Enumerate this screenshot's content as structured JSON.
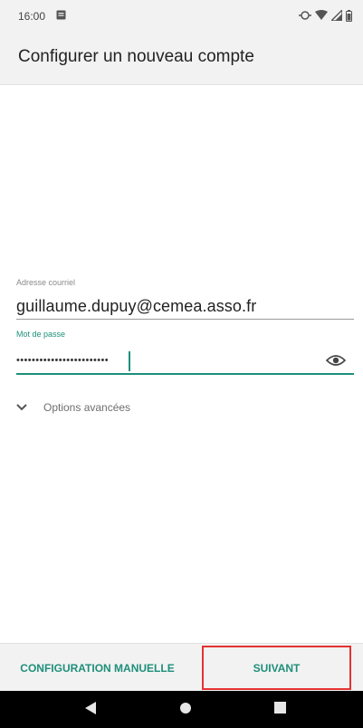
{
  "status_bar": {
    "time": "16:00",
    "icons": [
      "notification-icon",
      "sync-icon",
      "wifi-icon",
      "signal-icon",
      "battery-icon"
    ]
  },
  "app_bar": {
    "title": "Configurer un nouveau compte"
  },
  "form": {
    "email": {
      "label": "Adresse courriel",
      "value": "guillaume.dupuy@cemea.asso.fr"
    },
    "password": {
      "label": "Mot de passe",
      "masked_value": "••••••••••••••••••••••••",
      "toggle_icon": "eye-icon"
    },
    "advanced": {
      "label": "Options avancées",
      "icon": "chevron-down-icon"
    }
  },
  "actions": {
    "manual_label": "CONFIGURATION MANUELLE",
    "next_label": "SUIVANT"
  },
  "nav_bar": {
    "icons": [
      "back-icon",
      "home-icon",
      "recents-icon"
    ]
  },
  "colors": {
    "accent": "#1e8f7a",
    "highlight_border": "#e53232",
    "bar_background": "#f2f2f2",
    "nav_background": "#000000"
  }
}
